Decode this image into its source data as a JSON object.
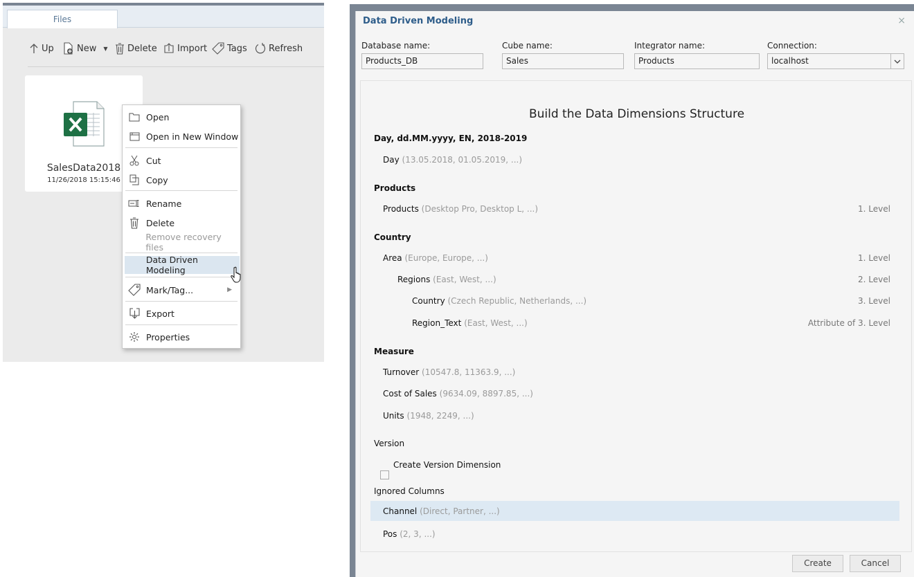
{
  "left": {
    "tab_files": "Files",
    "toolbar": {
      "up": "Up",
      "new": "New",
      "delete": "Delete",
      "import": "Import",
      "tags": "Tags",
      "refresh": "Refresh"
    },
    "file": {
      "name": "SalesData2018",
      "date": "11/26/2018 15:15:46"
    },
    "context_menu": {
      "open": "Open",
      "open_new_window": "Open in New Window",
      "cut": "Cut",
      "copy": "Copy",
      "rename": "Rename",
      "delete": "Delete",
      "remove_recovery": "Remove recovery files",
      "data_driven_modeling": "Data Driven Modeling",
      "mark_tag": "Mark/Tag...",
      "export": "Export",
      "properties": "Properties"
    }
  },
  "dialog": {
    "title": "Data Driven Modeling",
    "close": "×",
    "fields": {
      "database_label": "Database name:",
      "database_value": "Products_DB",
      "cube_label": "Cube name:",
      "cube_value": "Sales",
      "integrator_label": "Integrator name:",
      "integrator_value": "Products",
      "connection_label": "Connection:",
      "connection_value": "localhost"
    },
    "heading": "Build the Data Dimensions Structure",
    "groups": {
      "day": {
        "title": "Day, dd.MM.yyyy, EN, 2018-2019",
        "rows": [
          {
            "name": "Day",
            "examples": "(13.05.2018, 01.05.2019, ...)"
          }
        ]
      },
      "products": {
        "title": "Products",
        "rows": [
          {
            "name": "Products",
            "examples": "(Desktop Pro, Desktop L, ...)",
            "level": "1. Level"
          }
        ]
      },
      "country": {
        "title": "Country",
        "rows": [
          {
            "name": "Area",
            "examples": "(Europe, Europe, ...)",
            "level": "1. Level"
          },
          {
            "name": "Regions",
            "examples": "(East, West, ...)",
            "level": "2. Level"
          },
          {
            "name": "Country",
            "examples": "(Czech Republic, Netherlands, ...)",
            "level": "3. Level"
          },
          {
            "name": "Region_Text",
            "examples": "(East, West, ...)",
            "level": "Attribute of 3. Level"
          }
        ]
      },
      "measure": {
        "title": "Measure",
        "rows": [
          {
            "name": "Turnover",
            "examples": "(10547.8, 11363.9, ...)"
          },
          {
            "name": "Cost of Sales",
            "examples": "(9634.09, 8897.85, ...)"
          },
          {
            "name": "Units",
            "examples": "(1948, 2249, ...)"
          }
        ]
      },
      "version": {
        "title": "Version",
        "checkbox_label": "Create Version Dimension"
      },
      "ignored": {
        "title": "Ignored Columns",
        "rows": [
          {
            "name": "Channel",
            "examples": "(Direct, Partner, ...)"
          },
          {
            "name": "Pos",
            "examples": "(2, 3, ...)"
          }
        ]
      }
    },
    "buttons": {
      "create": "Create",
      "cancel": "Cancel"
    },
    "colors": {
      "title": "#2e5d8a",
      "selected_row": "#dde9f3",
      "frame": "#7a8593"
    }
  }
}
